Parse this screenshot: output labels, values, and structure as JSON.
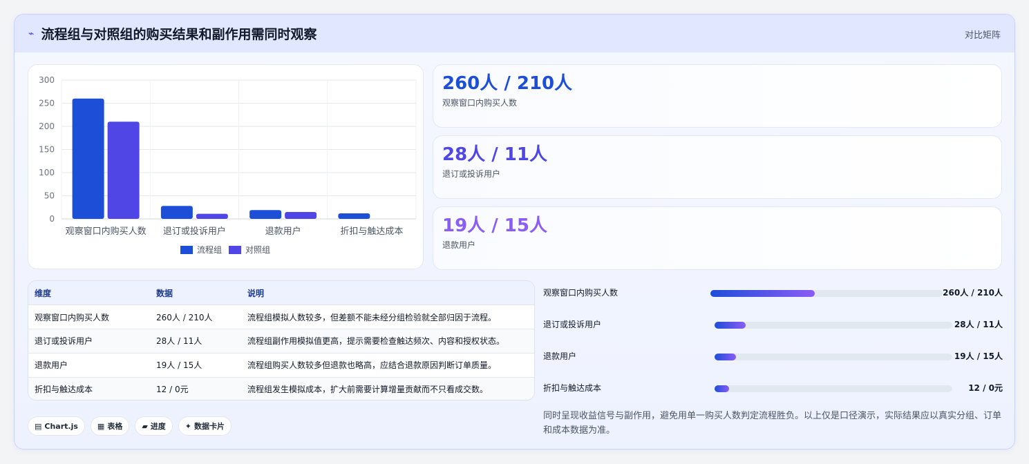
{
  "header": {
    "icon": "⌁",
    "title": "流程组与对照组的购买结果和副作用需同时观察",
    "tag": "对比矩阵"
  },
  "chart_data": {
    "type": "bar",
    "categories": [
      "观察窗口内购买人数",
      "退订或投诉用户",
      "退款用户",
      "折扣与触达成本"
    ],
    "series": [
      {
        "name": "流程组",
        "values": [
          260,
          28,
          19,
          12
        ],
        "color": "#1d4ed8"
      },
      {
        "name": "对照组",
        "values": [
          210,
          11,
          15,
          0
        ],
        "color": "#4f46e5"
      }
    ],
    "ylim": [
      0,
      300
    ],
    "yticks": [
      "0",
      "50",
      "100",
      "150",
      "200",
      "250",
      "300"
    ],
    "grid": true,
    "legend_position": "bottom"
  },
  "stats": [
    {
      "value": "260人 / 210人",
      "label": "观察窗口内购买人数",
      "color": "#1d4ed8"
    },
    {
      "value": "28人 / 11人",
      "label": "退订或投诉用户",
      "color": "#4f46e5"
    },
    {
      "value": "19人 / 15人",
      "label": "退款用户",
      "color": "#8b5cf6"
    }
  ],
  "table": {
    "headers": [
      "维度",
      "数据",
      "说明"
    ],
    "rows": [
      [
        "观察窗口内购买人数",
        "260人 / 210人",
        "流程组模拟人数较多，但差额不能未经分组检验就全部归因于流程。"
      ],
      [
        "退订或投诉用户",
        "28人 / 11人",
        "流程组副作用模拟值更高，提示需要检查触达频次、内容和授权状态。"
      ],
      [
        "退款用户",
        "19人 / 15人",
        "流程组购买人数较多但退款也略高，应结合退款原因判断订单质量。"
      ],
      [
        "折扣与触达成本",
        "12 / 0元",
        "流程组发生模拟成本，扩大前需要计算增量贡献而不只看成交数。"
      ]
    ]
  },
  "pills": [
    {
      "icon": "▤",
      "label": "Chart.js"
    },
    {
      "icon": "▦",
      "label": "表格"
    },
    {
      "icon": "▰",
      "label": "进度"
    },
    {
      "icon": "✦",
      "label": "数据卡片"
    }
  ],
  "progress": [
    {
      "label": "观察窗口内购买人数",
      "value": "260人 / 210人",
      "fraction": 0.45
    },
    {
      "label": "退订或投诉用户",
      "value": "28人 / 11人",
      "fraction": 0.13
    },
    {
      "label": "退款用户",
      "value": "19人 / 15人",
      "fraction": 0.09
    },
    {
      "label": "折扣与触达成本",
      "value": "12 / 0元",
      "fraction": 0.06
    }
  ],
  "note": "同时呈现收益信号与副作用，避免用单一购买人数判定流程胜负。以上仅是口径演示，实际结果应以真实分组、订单和成本数据为准。"
}
